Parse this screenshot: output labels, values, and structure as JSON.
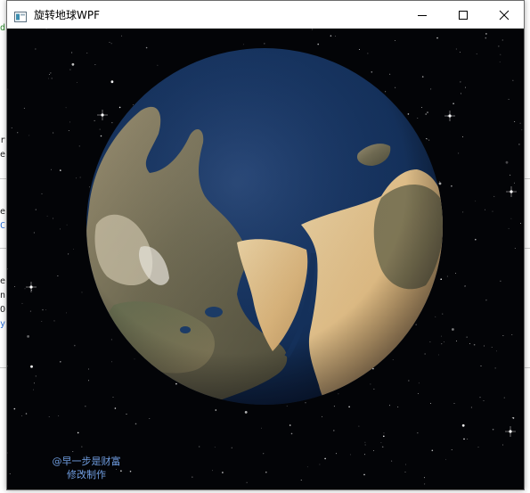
{
  "window": {
    "title": "旋转地球WPF",
    "controls": {
      "minimize": "minimize",
      "maximize": "maximize",
      "close": "close"
    }
  },
  "scene": {
    "credit_line1": "@早一步是财富",
    "credit_line2": "修改制作",
    "credit_color": "#6f9de0",
    "background_color": "#030407",
    "ocean_color": "#14305a"
  },
  "background_editor": {
    "fragments": [
      "d",
      "r",
      "e",
      "e",
      "C",
      "e",
      "n",
      "O",
      "y"
    ]
  }
}
